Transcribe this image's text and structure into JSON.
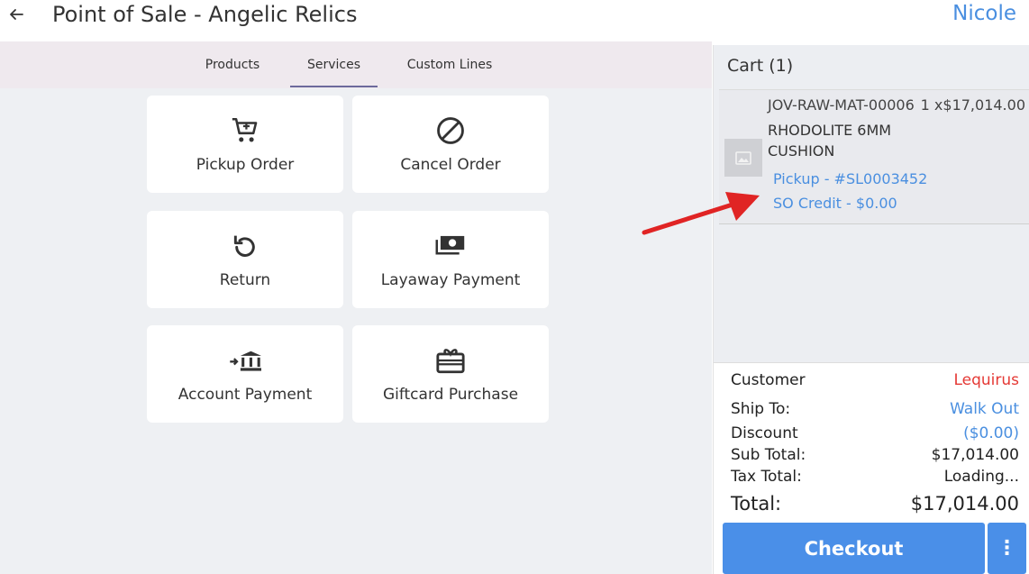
{
  "header": {
    "title": "Point of Sale - Angelic Relics",
    "user": "Nicole"
  },
  "tabs": [
    {
      "label": "Products",
      "active": false
    },
    {
      "label": "Services",
      "active": true
    },
    {
      "label": "Custom Lines",
      "active": false
    }
  ],
  "tiles": [
    {
      "label": "Pickup Order",
      "icon": "cart-icon"
    },
    {
      "label": "Cancel Order",
      "icon": "cancel-icon"
    },
    {
      "label": "Return",
      "icon": "undo-icon"
    },
    {
      "label": "Layaway Payment",
      "icon": "cash-icon"
    },
    {
      "label": "Account Payment",
      "icon": "bank-icon"
    },
    {
      "label": "Giftcard Purchase",
      "icon": "gift-card-icon"
    }
  ],
  "cart": {
    "title": "Cart (1)",
    "item": {
      "sku": "JOV-RAW-MAT-00006",
      "qty": "1 x$17,014.00",
      "description": "RHODOLITE 6MM CUSHION",
      "pickup": "Pickup - #SL0003452",
      "credit": "SO Credit - $0.00"
    },
    "summary": {
      "customer_label": "Customer",
      "customer_value": "Lequirus",
      "ship_label": "Ship To:",
      "ship_value": "Walk Out",
      "discount_label": "Discount",
      "discount_value": "($0.00)",
      "subtotal_label": "Sub Total:",
      "subtotal_value": "$17,014.00",
      "tax_label": "Tax Total:",
      "tax_value": "Loading...",
      "total_label": "Total:",
      "total_value": "$17,014.00"
    },
    "checkout_label": "Checkout",
    "more_label": "⋮"
  },
  "colors": {
    "accent": "#4a8fe8",
    "link": "#4a8fe0",
    "alert": "#e53935",
    "annotation_arrow": "#e02424"
  }
}
